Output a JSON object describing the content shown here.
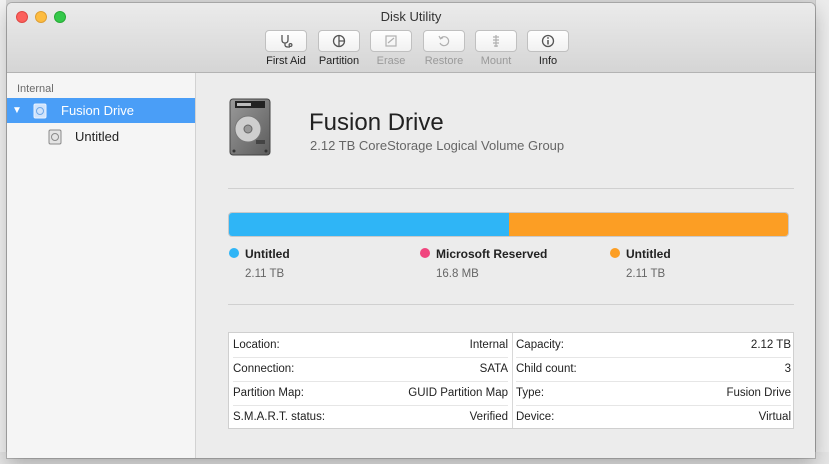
{
  "window": {
    "title": "Disk Utility"
  },
  "toolbar": {
    "items": [
      {
        "label": "First Aid",
        "icon": "stethoscope-icon",
        "enabled": true
      },
      {
        "label": "Partition",
        "icon": "pie-partition-icon",
        "enabled": true
      },
      {
        "label": "Erase",
        "icon": "erase-icon",
        "enabled": false
      },
      {
        "label": "Restore",
        "icon": "restore-icon",
        "enabled": false
      },
      {
        "label": "Mount",
        "icon": "mount-icon",
        "enabled": false
      },
      {
        "label": "Info",
        "icon": "info-icon",
        "enabled": true
      }
    ]
  },
  "sidebar": {
    "heading": "Internal",
    "items": [
      {
        "label": "Fusion Drive",
        "selected": true,
        "expanded": true,
        "icon": "hard-drive-icon"
      },
      {
        "label": "Untitled",
        "selected": false,
        "icon": "volume-icon"
      }
    ]
  },
  "disk": {
    "name": "Fusion Drive",
    "description": "2.12 TB CoreStorage Logical Volume Group",
    "icon": "hard-drive-icon"
  },
  "usage": {
    "segments": [
      {
        "name": "Untitled",
        "size": "2.11 TB",
        "color": "#2fb5f6",
        "fraction": 0.5
      },
      {
        "name": "Microsoft Reserved",
        "size": "16.8 MB",
        "color": "#f0457e",
        "fraction": 0.0
      },
      {
        "name": "Untitled",
        "size": "2.11 TB",
        "color": "#fc9e24",
        "fraction": 0.5
      }
    ]
  },
  "info": {
    "left": [
      {
        "label": "Location:",
        "value": "Internal"
      },
      {
        "label": "Connection:",
        "value": "SATA"
      },
      {
        "label": "Partition Map:",
        "value": "GUID Partition Map"
      },
      {
        "label": "S.M.A.R.T. status:",
        "value": "Verified"
      }
    ],
    "right": [
      {
        "label": "Capacity:",
        "value": "2.12 TB"
      },
      {
        "label": "Child count:",
        "value": "3"
      },
      {
        "label": "Type:",
        "value": "Fusion Drive"
      },
      {
        "label": "Device:",
        "value": "Virtual"
      }
    ]
  },
  "colors": {
    "selection": "#4a9ef7"
  }
}
